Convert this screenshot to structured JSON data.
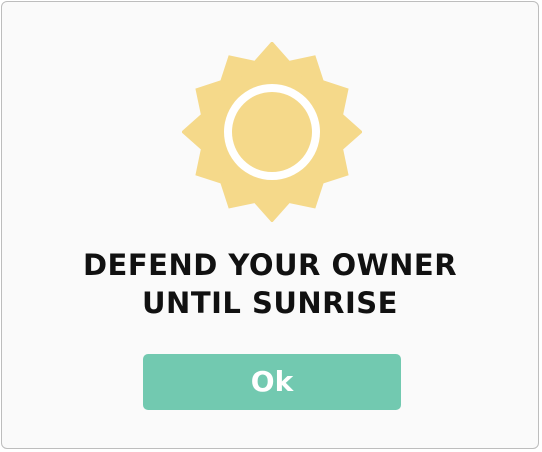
{
  "dialog": {
    "icon": "sun-icon",
    "message_line1": "DEFEND YOUR OWNER",
    "message_line2": "UNTIL SUNRISE",
    "ok_label": "Ok"
  },
  "colors": {
    "sun": "#f5d98a",
    "button": "#72c9b0",
    "button_text": "#ffffff",
    "text": "#111111",
    "background": "#fafafa"
  }
}
